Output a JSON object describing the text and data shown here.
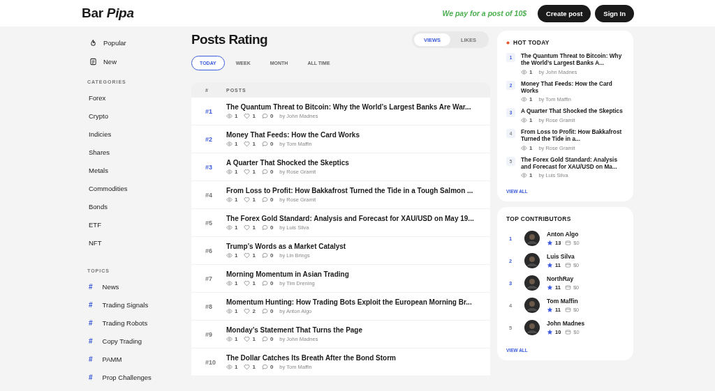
{
  "header": {
    "logo": "Bar *Pipa*",
    "promo": "We pay for a post of 10$",
    "buttons": [
      "Create post",
      "Sign In"
    ]
  },
  "sidebar": {
    "nav": [
      "Popular",
      "New"
    ],
    "categories_heading": "CATEGORIES",
    "categories": [
      "Forex",
      "Crypto",
      "Indicies",
      "Shares",
      "Metals",
      "Commodities",
      "Bonds",
      "ETF",
      "NFT"
    ],
    "topics_heading": "TOPICS",
    "topics": [
      {
        "mark": "#",
        "label": "News"
      },
      {
        "mark": "#",
        "label": "Trading Signals"
      },
      {
        "mark": "#",
        "label": "Trading Robots"
      },
      {
        "mark": "#",
        "label": "Copy Trading"
      },
      {
        "mark": "#",
        "label": "PAMM"
      },
      {
        "mark": "#",
        "label": "Prop Challenges"
      }
    ]
  },
  "main": {
    "title": "Posts Rating",
    "metric_toggle": [
      {
        "label": "VIEWS",
        "selected": true
      },
      {
        "label": "LIKES",
        "selected": false
      }
    ],
    "periods": [
      {
        "label": "TODAY",
        "selected": true
      },
      {
        "label": "WEEK",
        "selected": false
      },
      {
        "label": "MONTH",
        "selected": false
      },
      {
        "label": "ALL TIME",
        "selected": false
      }
    ],
    "table": {
      "columns": [
        "#",
        "POSTS"
      ],
      "rows": [
        {
          "rank": "#1",
          "highlighted": true,
          "title": "The Quantum Threat to Bitcoin: Why the World’s Largest Banks Are War...",
          "views": "1",
          "likes": "1",
          "comments": "0",
          "author": "by John Madnes"
        },
        {
          "rank": "#2",
          "highlighted": true,
          "title": "Money That Feeds: How the Card Works",
          "views": "1",
          "likes": "1",
          "comments": "0",
          "author": "by Tom Maffin"
        },
        {
          "rank": "#3",
          "highlighted": true,
          "title": "A Quarter That Shocked the Skeptics",
          "views": "1",
          "likes": "1",
          "comments": "0",
          "author": "by Rose Gramit"
        },
        {
          "rank": "#4",
          "highlighted": false,
          "title": "From Loss to Profit: How Bakkafrost Turned the Tide in a Tough Salmon ...",
          "views": "1",
          "likes": "1",
          "comments": "0",
          "author": "by Rose Gramit"
        },
        {
          "rank": "#5",
          "highlighted": false,
          "title": "The Forex Gold Standard: Analysis and Forecast for XAU/USD on May 19...",
          "views": "1",
          "likes": "1",
          "comments": "0",
          "author": "by Luis Silva"
        },
        {
          "rank": "#6",
          "highlighted": false,
          "title": "Trump’s Words as a Market Catalyst",
          "views": "1",
          "likes": "1",
          "comments": "0",
          "author": "by Lin Brings"
        },
        {
          "rank": "#7",
          "highlighted": false,
          "title": "Morning Momentum in Asian Trading",
          "views": "1",
          "likes": "1",
          "comments": "0",
          "author": "by Tim Drening"
        },
        {
          "rank": "#8",
          "highlighted": false,
          "title": "Momentum Hunting: How Trading Bots Exploit the European Morning Br...",
          "views": "1",
          "likes": "2",
          "comments": "0",
          "author": "by Anton Algo"
        },
        {
          "rank": "#9",
          "highlighted": false,
          "title": "Monday’s Statement That Turns the Page",
          "views": "1",
          "likes": "1",
          "comments": "0",
          "author": "by John Madnes"
        },
        {
          "rank": "#10",
          "highlighted": false,
          "title": "The Dollar Catches Its Breath After the Bond Storm",
          "views": "1",
          "likes": "1",
          "comments": "0",
          "author": "by Tom Maffin"
        }
      ]
    }
  },
  "hot_today": {
    "title": "HOT TODAY",
    "items": [
      {
        "rank": "1",
        "highlighted": true,
        "title": "The Quantum Threat to Bitcoin: Why the World’s Largest Banks A...",
        "views": "1",
        "author": "by John Madnes"
      },
      {
        "rank": "2",
        "highlighted": true,
        "title": "Money That Feeds: How the Card Works",
        "views": "1",
        "author": "by Tom Maffin"
      },
      {
        "rank": "3",
        "highlighted": true,
        "title": "A Quarter That Shocked the Skeptics",
        "views": "1",
        "author": "by Rose Gramit"
      },
      {
        "rank": "4",
        "highlighted": false,
        "title": "From Loss to Profit: How Bakkafrost Turned the Tide in a...",
        "views": "1",
        "author": "by Rose Gramit"
      },
      {
        "rank": "5",
        "highlighted": false,
        "title": "The Forex Gold Standard: Analysis and Forecast for XAU/USD on Ma...",
        "views": "1",
        "author": "by Luis Silva"
      }
    ],
    "link": "VIEW ALL"
  },
  "top_contributors": {
    "title": "TOP CONTRIBUTORS",
    "items": [
      {
        "rank": "1",
        "highlighted": true,
        "name": "Anton Algo",
        "rating": "13",
        "earnings": "$0"
      },
      {
        "rank": "2",
        "highlighted": true,
        "name": "Luis Silva",
        "rating": "11",
        "earnings": "$0"
      },
      {
        "rank": "3",
        "highlighted": true,
        "name": "NorthRay",
        "rating": "11",
        "earnings": "$0"
      },
      {
        "rank": "4",
        "highlighted": false,
        "name": "Tom Maffin",
        "rating": "11",
        "earnings": "$0"
      },
      {
        "rank": "5",
        "highlighted": false,
        "name": "John Madnes",
        "rating": "10",
        "earnings": "$0"
      }
    ],
    "link": "VIEW ALL"
  }
}
